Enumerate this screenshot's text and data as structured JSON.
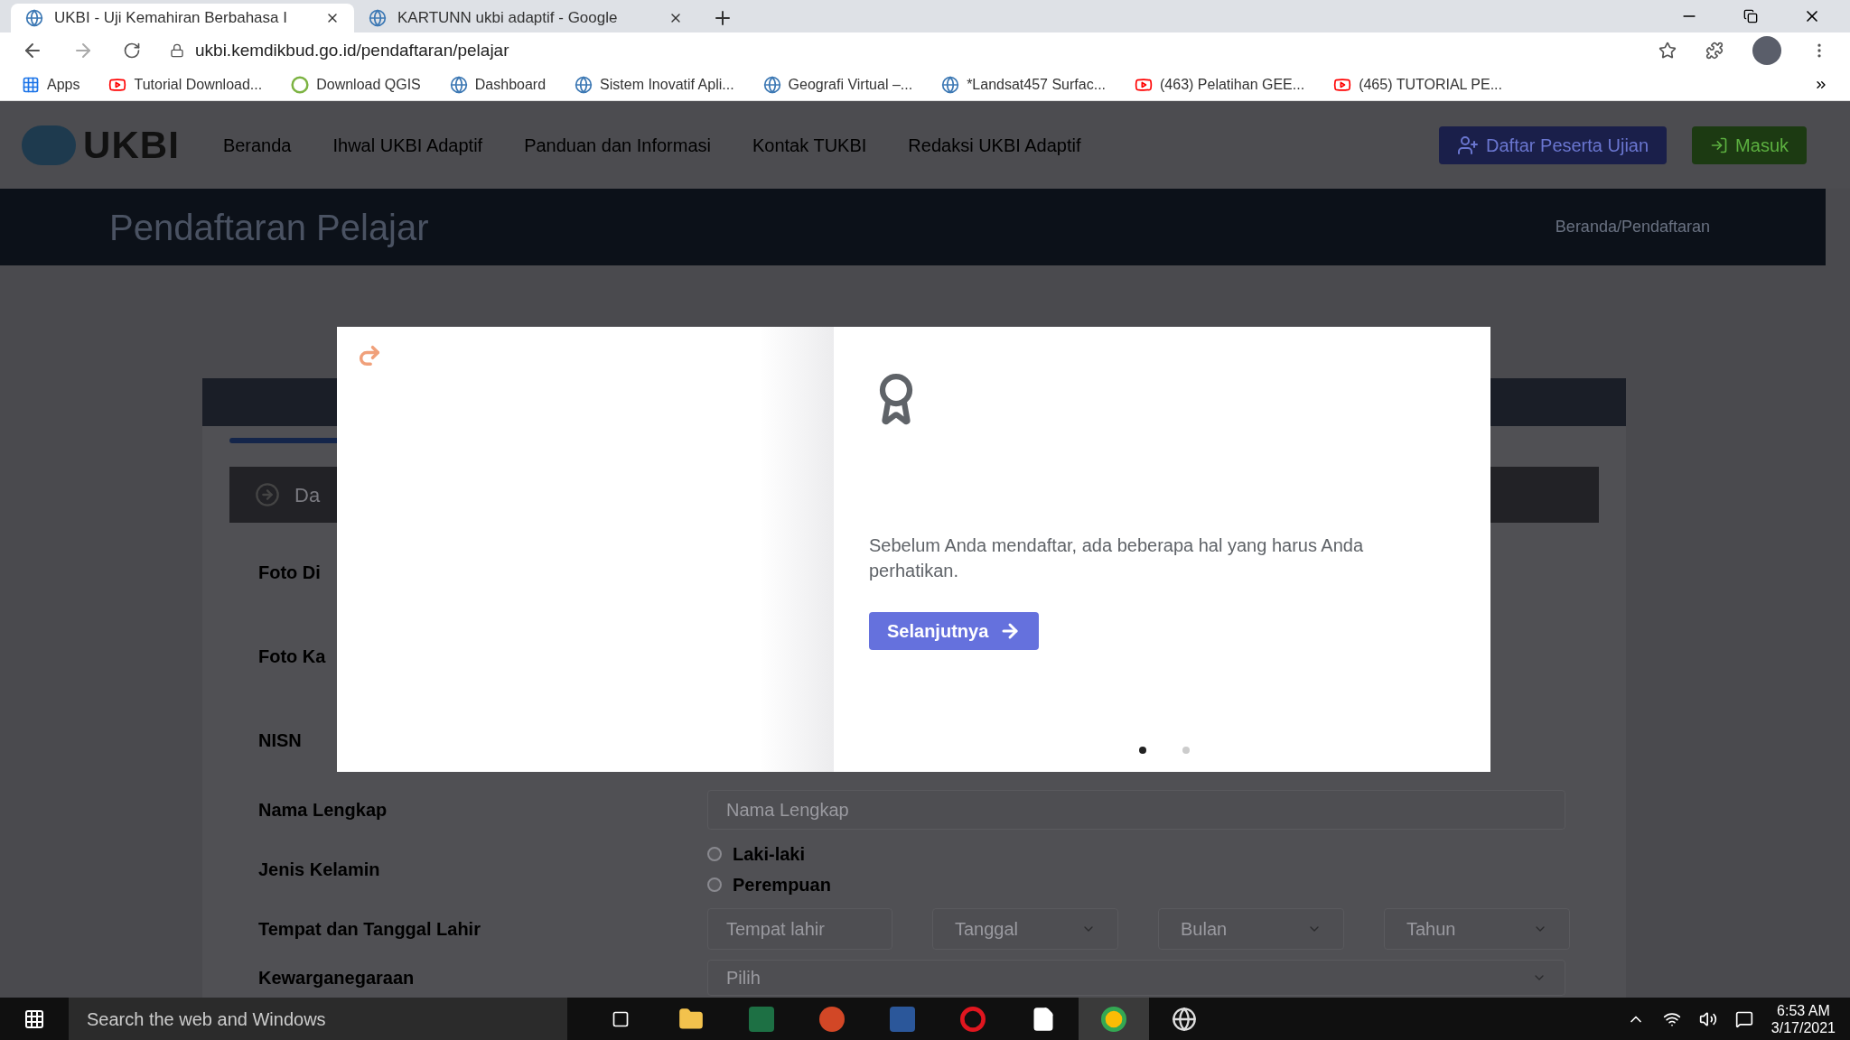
{
  "browser": {
    "tabs": [
      {
        "title": "UKBI - Uji Kemahiran Berbahasa I",
        "selected": true
      },
      {
        "title": "KARTUNN ukbi adaptif - Google",
        "selected": false
      }
    ],
    "url": "ukbi.kemdikbud.go.id/pendaftaran/pelajar",
    "bookmarks": [
      {
        "label": "Apps",
        "kind": "apps"
      },
      {
        "label": "Tutorial Download...",
        "kind": "youtube"
      },
      {
        "label": "Download QGIS",
        "kind": "qgis"
      },
      {
        "label": "Dashboard",
        "kind": "globe"
      },
      {
        "label": "Sistem Inovatif Apli...",
        "kind": "globe"
      },
      {
        "label": "Geografi Virtual –...",
        "kind": "globe"
      },
      {
        "label": "*Landsat457 Surfac...",
        "kind": "globe"
      },
      {
        "label": "(463) Pelatihan GEE...",
        "kind": "youtube"
      },
      {
        "label": "(465) TUTORIAL PE...",
        "kind": "youtube"
      }
    ]
  },
  "site": {
    "logo": "UKBI",
    "nav": [
      "Beranda",
      "Ihwal UKBI Adaptif",
      "Panduan dan Informasi",
      "Kontak TUKBI",
      "Redaksi UKBI Adaptif"
    ],
    "register_button": "Daftar Peserta Ujian",
    "login_button": "Masuk"
  },
  "banner": {
    "title": "Pendaftaran Pelajar",
    "breadcrumb": "Beranda/Pendaftaran"
  },
  "form": {
    "step": "Da",
    "rows": [
      {
        "kind": "label",
        "label": "Foto Di"
      },
      {
        "kind": "label",
        "label": "Foto Ka"
      },
      {
        "kind": "label",
        "label": "NISN"
      },
      {
        "kind": "text",
        "label": "Nama Lengkap",
        "placeholder": "Nama Lengkap"
      },
      {
        "kind": "radio",
        "label": "Jenis Kelamin",
        "options": [
          {
            "label": "Laki-laki",
            "selected": false
          },
          {
            "label": "Perempuan",
            "selected": false
          }
        ]
      },
      {
        "kind": "birth",
        "label": "Tempat dan Tanggal Lahir",
        "placeholder": "Tempat lahir",
        "selects": [
          "Tanggal",
          "Bulan",
          "Tahun"
        ]
      },
      {
        "kind": "select",
        "label": "Kewarganegaraan",
        "value": "Pilih"
      }
    ]
  },
  "modal": {
    "text": "Sebelum Anda mendaftar, ada beberapa hal yang harus Anda perhatikan.",
    "button": "Selanjutnya",
    "dots": [
      {
        "selected": true
      },
      {
        "selected": false
      }
    ]
  },
  "taskbar": {
    "search": "Search the web and Windows",
    "time": "6:53 AM",
    "date": "3/17/2021"
  }
}
